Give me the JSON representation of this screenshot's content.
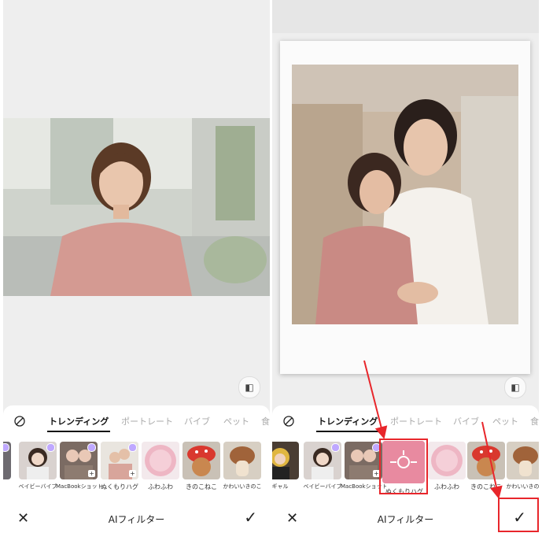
{
  "panels": [
    {
      "tabs": [
        "トレンディング",
        "ポートレート",
        "バイブ",
        "ペット",
        "食"
      ],
      "filters": [
        {
          "label": "",
          "icon": "partial-thumb"
        },
        {
          "label": "ベイビーバイブ",
          "icon": "baby-vibe-thumb"
        },
        {
          "label": "MacBookショット",
          "icon": "macbook-shot-thumb"
        },
        {
          "label": "ぬくもりハグ",
          "icon": "warm-hug-thumb"
        },
        {
          "label": "ふわふわ",
          "icon": "fluffy-thumb"
        },
        {
          "label": "きのこねこ",
          "icon": "mushroom-cat-thumb"
        },
        {
          "label": "かわいいきのこ",
          "icon": "cute-mushroom-thumb"
        }
      ],
      "action_title": "AIフィルター"
    },
    {
      "tabs": [
        "トレンディング",
        "ポートレート",
        "バイブ",
        "ペット",
        "食"
      ],
      "filters": [
        {
          "label": "ギャル",
          "icon": "gal-thumb"
        },
        {
          "label": "ベイビーバイブ",
          "icon": "baby-vibe-thumb"
        },
        {
          "label": "MacBookショット",
          "icon": "macbook-shot-thumb"
        },
        {
          "label": "ぬくもりハグ",
          "icon": "warm-hug-loading-thumb"
        },
        {
          "label": "ふわふわ",
          "icon": "fluffy-thumb"
        },
        {
          "label": "きのこねこ",
          "icon": "mushroom-cat-thumb"
        },
        {
          "label": "かわいいきのこ",
          "icon": "cute-mushroom-thumb"
        }
      ],
      "action_title": "AIフィルター"
    }
  ],
  "colors": {
    "accent_red": "#e8262b",
    "badge": "#bfa8ff"
  }
}
